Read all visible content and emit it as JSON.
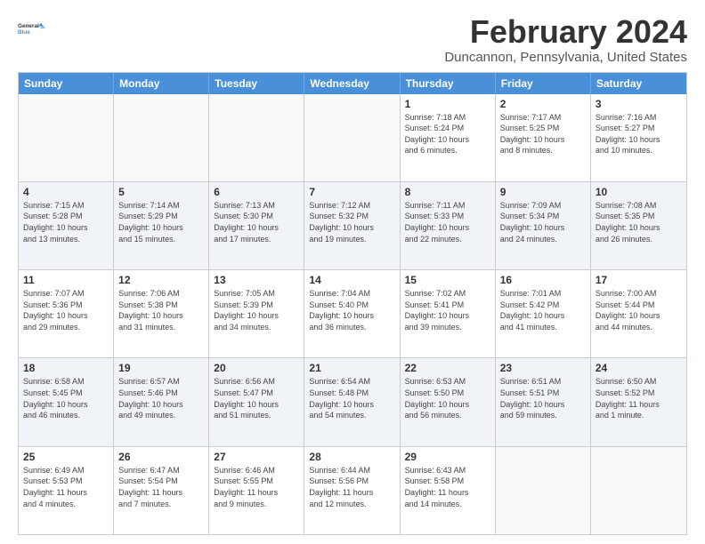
{
  "logo": {
    "line1": "General",
    "line2": "Blue"
  },
  "title": "February 2024",
  "subtitle": "Duncannon, Pennsylvania, United States",
  "header_days": [
    "Sunday",
    "Monday",
    "Tuesday",
    "Wednesday",
    "Thursday",
    "Friday",
    "Saturday"
  ],
  "rows": [
    [
      {
        "day": "",
        "info": ""
      },
      {
        "day": "",
        "info": ""
      },
      {
        "day": "",
        "info": ""
      },
      {
        "day": "",
        "info": ""
      },
      {
        "day": "1",
        "info": "Sunrise: 7:18 AM\nSunset: 5:24 PM\nDaylight: 10 hours\nand 6 minutes."
      },
      {
        "day": "2",
        "info": "Sunrise: 7:17 AM\nSunset: 5:25 PM\nDaylight: 10 hours\nand 8 minutes."
      },
      {
        "day": "3",
        "info": "Sunrise: 7:16 AM\nSunset: 5:27 PM\nDaylight: 10 hours\nand 10 minutes."
      }
    ],
    [
      {
        "day": "4",
        "info": "Sunrise: 7:15 AM\nSunset: 5:28 PM\nDaylight: 10 hours\nand 13 minutes."
      },
      {
        "day": "5",
        "info": "Sunrise: 7:14 AM\nSunset: 5:29 PM\nDaylight: 10 hours\nand 15 minutes."
      },
      {
        "day": "6",
        "info": "Sunrise: 7:13 AM\nSunset: 5:30 PM\nDaylight: 10 hours\nand 17 minutes."
      },
      {
        "day": "7",
        "info": "Sunrise: 7:12 AM\nSunset: 5:32 PM\nDaylight: 10 hours\nand 19 minutes."
      },
      {
        "day": "8",
        "info": "Sunrise: 7:11 AM\nSunset: 5:33 PM\nDaylight: 10 hours\nand 22 minutes."
      },
      {
        "day": "9",
        "info": "Sunrise: 7:09 AM\nSunset: 5:34 PM\nDaylight: 10 hours\nand 24 minutes."
      },
      {
        "day": "10",
        "info": "Sunrise: 7:08 AM\nSunset: 5:35 PM\nDaylight: 10 hours\nand 26 minutes."
      }
    ],
    [
      {
        "day": "11",
        "info": "Sunrise: 7:07 AM\nSunset: 5:36 PM\nDaylight: 10 hours\nand 29 minutes."
      },
      {
        "day": "12",
        "info": "Sunrise: 7:06 AM\nSunset: 5:38 PM\nDaylight: 10 hours\nand 31 minutes."
      },
      {
        "day": "13",
        "info": "Sunrise: 7:05 AM\nSunset: 5:39 PM\nDaylight: 10 hours\nand 34 minutes."
      },
      {
        "day": "14",
        "info": "Sunrise: 7:04 AM\nSunset: 5:40 PM\nDaylight: 10 hours\nand 36 minutes."
      },
      {
        "day": "15",
        "info": "Sunrise: 7:02 AM\nSunset: 5:41 PM\nDaylight: 10 hours\nand 39 minutes."
      },
      {
        "day": "16",
        "info": "Sunrise: 7:01 AM\nSunset: 5:42 PM\nDaylight: 10 hours\nand 41 minutes."
      },
      {
        "day": "17",
        "info": "Sunrise: 7:00 AM\nSunset: 5:44 PM\nDaylight: 10 hours\nand 44 minutes."
      }
    ],
    [
      {
        "day": "18",
        "info": "Sunrise: 6:58 AM\nSunset: 5:45 PM\nDaylight: 10 hours\nand 46 minutes."
      },
      {
        "day": "19",
        "info": "Sunrise: 6:57 AM\nSunset: 5:46 PM\nDaylight: 10 hours\nand 49 minutes."
      },
      {
        "day": "20",
        "info": "Sunrise: 6:56 AM\nSunset: 5:47 PM\nDaylight: 10 hours\nand 51 minutes."
      },
      {
        "day": "21",
        "info": "Sunrise: 6:54 AM\nSunset: 5:48 PM\nDaylight: 10 hours\nand 54 minutes."
      },
      {
        "day": "22",
        "info": "Sunrise: 6:53 AM\nSunset: 5:50 PM\nDaylight: 10 hours\nand 56 minutes."
      },
      {
        "day": "23",
        "info": "Sunrise: 6:51 AM\nSunset: 5:51 PM\nDaylight: 10 hours\nand 59 minutes."
      },
      {
        "day": "24",
        "info": "Sunrise: 6:50 AM\nSunset: 5:52 PM\nDaylight: 11 hours\nand 1 minute."
      }
    ],
    [
      {
        "day": "25",
        "info": "Sunrise: 6:49 AM\nSunset: 5:53 PM\nDaylight: 11 hours\nand 4 minutes."
      },
      {
        "day": "26",
        "info": "Sunrise: 6:47 AM\nSunset: 5:54 PM\nDaylight: 11 hours\nand 7 minutes."
      },
      {
        "day": "27",
        "info": "Sunrise: 6:46 AM\nSunset: 5:55 PM\nDaylight: 11 hours\nand 9 minutes."
      },
      {
        "day": "28",
        "info": "Sunrise: 6:44 AM\nSunset: 5:56 PM\nDaylight: 11 hours\nand 12 minutes."
      },
      {
        "day": "29",
        "info": "Sunrise: 6:43 AM\nSunset: 5:58 PM\nDaylight: 11 hours\nand 14 minutes."
      },
      {
        "day": "",
        "info": ""
      },
      {
        "day": "",
        "info": ""
      }
    ]
  ]
}
